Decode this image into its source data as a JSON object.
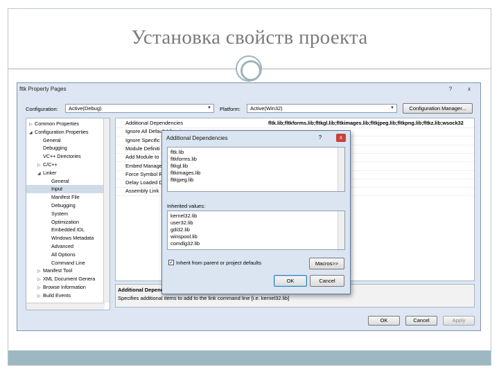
{
  "slide": {
    "title": "Установка свойств проекта"
  },
  "window": {
    "title": "fltk Property Pages",
    "controls": [
      "?",
      "x"
    ]
  },
  "toolbar": {
    "configuration_label": "Configuration:",
    "configuration_value": "Active(Debug)",
    "platform_label": "Platform:",
    "platform_value": "Active(Win32)",
    "config_manager_label": "Configuration Manager..."
  },
  "tree": {
    "items": [
      {
        "label": "Common Properties",
        "level": 0,
        "expander": "▷"
      },
      {
        "label": "Configuration Properties",
        "level": 0,
        "expander": "◢"
      },
      {
        "label": "General",
        "level": 1,
        "expander": ""
      },
      {
        "label": "Debugging",
        "level": 1,
        "expander": ""
      },
      {
        "label": "VC++ Directories",
        "level": 1,
        "expander": ""
      },
      {
        "label": "C/C++",
        "level": 1,
        "expander": "▷"
      },
      {
        "label": "Linker",
        "level": 1,
        "expander": "◢"
      },
      {
        "label": "General",
        "level": 2,
        "expander": ""
      },
      {
        "label": "Input",
        "level": 2,
        "expander": "",
        "selected": true
      },
      {
        "label": "Manifest File",
        "level": 2,
        "expander": ""
      },
      {
        "label": "Debugging",
        "level": 2,
        "expander": ""
      },
      {
        "label": "System",
        "level": 2,
        "expander": ""
      },
      {
        "label": "Optimization",
        "level": 2,
        "expander": ""
      },
      {
        "label": "Embedded IDL",
        "level": 2,
        "expander": ""
      },
      {
        "label": "Windows Metadata",
        "level": 2,
        "expander": ""
      },
      {
        "label": "Advanced",
        "level": 2,
        "expander": ""
      },
      {
        "label": "All Options",
        "level": 2,
        "expander": ""
      },
      {
        "label": "Command Line",
        "level": 2,
        "expander": ""
      },
      {
        "label": "Manifest Tool",
        "level": 1,
        "expander": "▷"
      },
      {
        "label": "XML Document Genera",
        "level": 1,
        "expander": "▷"
      },
      {
        "label": "Browse Information",
        "level": 1,
        "expander": "▷"
      },
      {
        "label": "Build Events",
        "level": 1,
        "expander": "▷"
      }
    ]
  },
  "grid": {
    "rows": [
      {
        "name": "Additional Dependencies",
        "value": "fltk.lib;fltkforms.lib;fltkgl.lib;fltkimages.lib;fltkjpeg.lib;fltkpng.lib;fltkz.lib;wsock32"
      },
      {
        "name": "Ignore All Default Libraries",
        "value": ""
      },
      {
        "name": "Ignore Specific",
        "value": ""
      },
      {
        "name": "Module Definiti",
        "value": ""
      },
      {
        "name": "Add Module to",
        "value": ""
      },
      {
        "name": "Embed Manage",
        "value": ""
      },
      {
        "name": "Force Symbol R",
        "value": ""
      },
      {
        "name": "Delay Loaded D",
        "value": ""
      },
      {
        "name": "Assembly Link",
        "value": ""
      }
    ]
  },
  "description": {
    "title": "Additional Depende",
    "text": "Specifies additional items to add to the link command line [i.e. kernel32.lib]"
  },
  "footer": {
    "ok_label": "OK",
    "cancel_label": "Cancel",
    "apply_label": "Apply"
  },
  "dialog": {
    "title": "Additional Dependencies",
    "controls": [
      "?",
      "x"
    ],
    "dependencies": [
      "fltk.lib",
      "fltkforms.lib",
      "fltkgl.lib",
      "fltkimages.lib",
      "fltkjpeg.lib"
    ],
    "inherited_label": "Inherited values:",
    "inherited": [
      "kernel32.lib",
      "user32.lib",
      "gdi32.lib",
      "winspool.lib",
      "comdlg32.lib"
    ],
    "inherit_checkbox_label": "Inherit from parent or project defaults",
    "inherit_checked": true,
    "macros_label": "Macros>>",
    "ok_label": "OK",
    "cancel_label": "Cancel"
  }
}
